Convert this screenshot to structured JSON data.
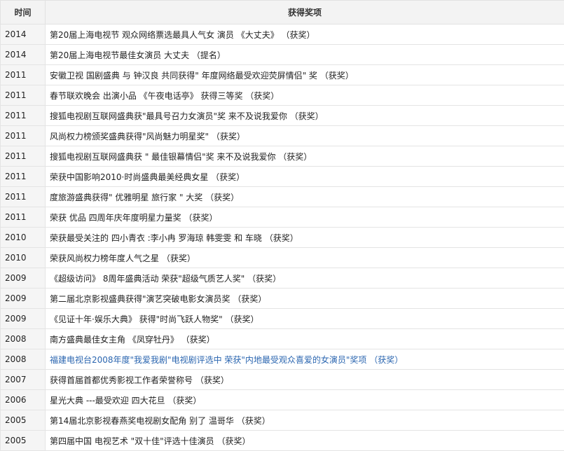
{
  "table": {
    "headers": {
      "year": "时间",
      "award": "获得奖项"
    },
    "link_color": "#2b66b0",
    "rows": [
      {
        "year": "2014",
        "award": "第20届上海电视节  观众网络票选最具人气女 演员 《大丈夫》 （获奖）",
        "link": false
      },
      {
        "year": "2014",
        "award": "第20届上海电视节最佳女演员 大丈夫 （提名）",
        "link": false
      },
      {
        "year": "2011",
        "award": "安徽卫视  国剧盛典 与 钟汉良 共同获得\" 年度网络最受欢迎荧屏情侣\" 奖 （获奖）",
        "link": false
      },
      {
        "year": "2011",
        "award": "春节联欢晚会  出演小品 《午夜电话亭》 获得三等奖 （获奖）",
        "link": false
      },
      {
        "year": "2011",
        "award": "搜狐电视剧互联网盛典获\"最具号召力女演员\"奖 来不及说我爱你  （获奖）",
        "link": false
      },
      {
        "year": "2011",
        "award": "风尚权力榜颁奖盛典获得\"风尚魅力明星奖\"  （获奖）",
        "link": false
      },
      {
        "year": "2011",
        "award": "搜狐电视剧互联网盛典获  \" 最佳银幕情侣\"奖 来不及说我爱你  （获奖）",
        "link": false
      },
      {
        "year": "2011",
        "award": "荣获中国影响2010·时尚盛典最美经典女星  （获奖）",
        "link": false
      },
      {
        "year": "2011",
        "award": "度旅游盛典获得\" 优雅明星 旅行家 \" 大奖  （获奖）",
        "link": false
      },
      {
        "year": "2011",
        "award": "荣获  优品 四周年庆年度明星力量奖  （获奖）",
        "link": false
      },
      {
        "year": "2010",
        "award": "荣获最受关注的  四小青衣 :李小冉 罗海琼 韩雯雯 和 车晓  （获奖）",
        "link": false
      },
      {
        "year": "2010",
        "award": "荣获风尚权力榜年度人气之星  （获奖）",
        "link": false
      },
      {
        "year": "2009",
        "award": "《超级访问》 8周年盛典活动 荣获\"超级气质艺人奖\" （获奖）",
        "link": false
      },
      {
        "year": "2009",
        "award": "第二届北京影视盛典获得\"演艺突破电影女演员奖  （获奖）",
        "link": false
      },
      {
        "year": "2009",
        "award": "《见证十年·娱乐大典》  获得\"时尚飞跃人物奖\" （获奖）",
        "link": false
      },
      {
        "year": "2008",
        "award": "南方盛典最佳女主角 《凤穿牡丹》 （获奖）",
        "link": false
      },
      {
        "year": "2008",
        "award": "福建电视台2008年度\"我爱我剧\"电视剧评选中  荣获\"内地最受观众喜爱的女演员\"奖项   （获奖）",
        "link": true
      },
      {
        "year": "2007",
        "award": "获得首届首都优秀影视工作者荣誉称号  （获奖）",
        "link": false
      },
      {
        "year": "2006",
        "award": "星光大典  ---最受欢迎 四大花旦  （获奖）",
        "link": false
      },
      {
        "year": "2005",
        "award": "第14届北京影视春燕奖电视剧女配角  别了 温哥华  （获奖）",
        "link": false
      },
      {
        "year": "2005",
        "award": "第四届中国 电视艺术 \"双十佳\"评选十佳演员  （获奖）",
        "link": false
      }
    ]
  }
}
